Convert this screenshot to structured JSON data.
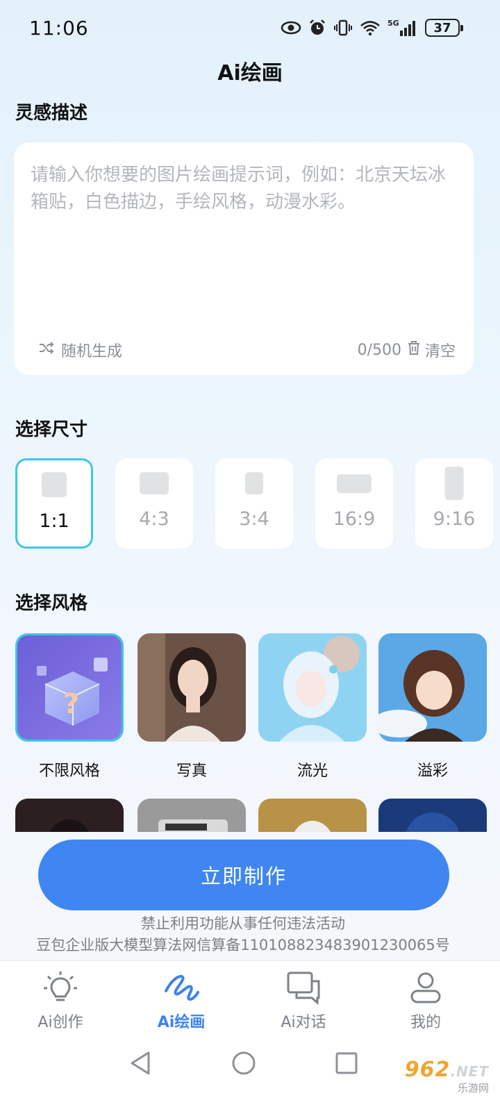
{
  "status": {
    "time": "11:06",
    "battery": "37",
    "network": "5G"
  },
  "page_title": "Ai绘画",
  "inspiration": {
    "title": "灵感描述",
    "placeholder": "请输入你想要的图片绘画提示词，例如：北京天坛冰箱贴，白色描边，手绘风格，动漫水彩。",
    "random_label": "随机生成",
    "counter": "0/500",
    "clear_label": "清空"
  },
  "size": {
    "title": "选择尺寸",
    "options": [
      "1:1",
      "4:3",
      "3:4",
      "16:9",
      "9:16"
    ],
    "selected": "1:1"
  },
  "style": {
    "title": "选择风格",
    "items": [
      "不限风格",
      "写真",
      "流光",
      "溢彩"
    ],
    "selected": "不限风格"
  },
  "cta_label": "立即制作",
  "notice_line1": "禁止利用功能从事任何违法活动",
  "notice_line2": "豆包企业版大模型算法网信算备110108823483901230065号",
  "tabs": [
    "Ai创作",
    "Ai绘画",
    "Ai对话",
    "我的"
  ],
  "active_tab": "Ai绘画",
  "watermark": {
    "big": "962",
    "net": ".NET",
    "small": "乐游网"
  },
  "colors": {
    "accent": "#3f86f2",
    "selected_border": "#38c8e8",
    "active_tab": "#3c82ee"
  }
}
